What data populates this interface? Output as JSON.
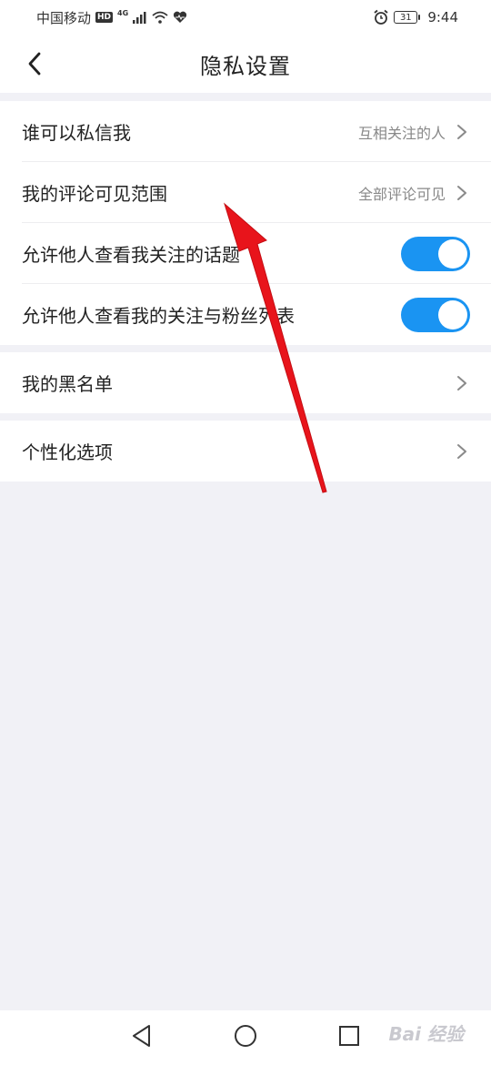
{
  "status_bar": {
    "carrier": "中国移动",
    "hd": "HD",
    "network": "4G",
    "battery": "31",
    "time": "9:44"
  },
  "header": {
    "title": "隐私设置",
    "back_icon": "chevron-left-icon"
  },
  "settings": {
    "dm_label": "谁可以私信我",
    "dm_value": "互相关注的人",
    "comment_label": "我的评论可见范围",
    "comment_value": "全部评论可见",
    "topics_label": "允许他人查看我关注的话题",
    "topics_enabled": true,
    "follows_label": "允许他人查看我的关注与粉丝列表",
    "follows_enabled": true,
    "blacklist_label": "我的黑名单",
    "personalize_label": "个性化选项"
  },
  "system_nav": {
    "back_icon": "triangle-back-icon",
    "home_icon": "circle-home-icon",
    "recents_icon": "square-recents-icon"
  },
  "watermark": "Bai 经验",
  "colors": {
    "toggle_on": "#1a94f2",
    "background": "#f1f1f6",
    "annotation_arrow": "#e8141b"
  }
}
